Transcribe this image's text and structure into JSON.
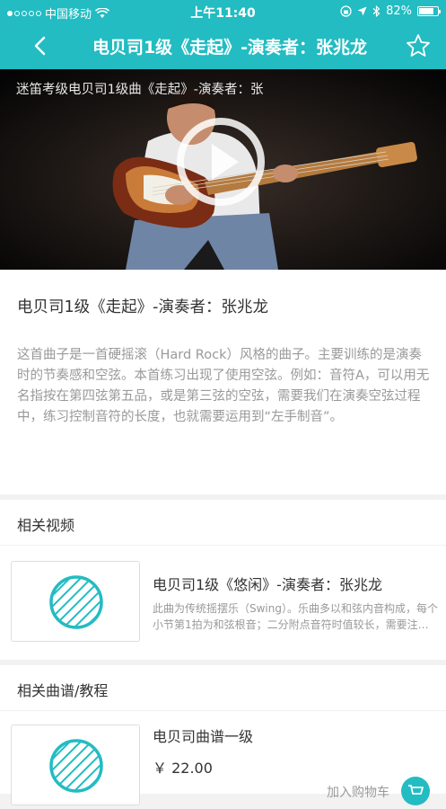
{
  "status_bar": {
    "carrier": "中国移动",
    "time": "上午11:40",
    "battery": "82%",
    "battery_level": 0.82
  },
  "nav": {
    "title": "电贝司1级《走起》-演奏者：张兆龙",
    "back_icon": "chevron-left-icon",
    "favorite_icon": "star-outline-icon"
  },
  "video": {
    "caption": "迷笛考级电贝司1级曲《走起》-演奏者：张"
  },
  "detail": {
    "title": "电贝司1级《走起》-演奏者：张兆龙",
    "description": "这首曲子是一首硬摇滚（Hard Rock）风格的曲子。主要训练的是演奏时的节奏感和空弦。本首练习出现了使用空弦。例如：音符A，可以用无名指按在第四弦第五品，或是第三弦的空弦，需要我们在演奏空弦过程中，练习控制音符的长度，也就需要运用到“左手制音”。"
  },
  "related_videos": {
    "header": "相关视频",
    "items": [
      {
        "title": "电贝司1级《悠闲》-演奏者：张兆龙",
        "description": "此曲为传统摇摆乐（Swing）。乐曲多以和弦内音构成，每个小节第1拍为和弦根音；二分附点音符时值较长，需要注意音符的时值。"
      }
    ]
  },
  "related_scores": {
    "header": "相关曲谱/教程",
    "items": [
      {
        "title": "电贝司曲谱一级",
        "price": "￥ 22.00",
        "cart_label": "加入购物车"
      }
    ]
  },
  "colors": {
    "accent": "#22bcc2",
    "text_primary": "#333333",
    "text_secondary": "#999999",
    "background": "#f2f2f2"
  }
}
